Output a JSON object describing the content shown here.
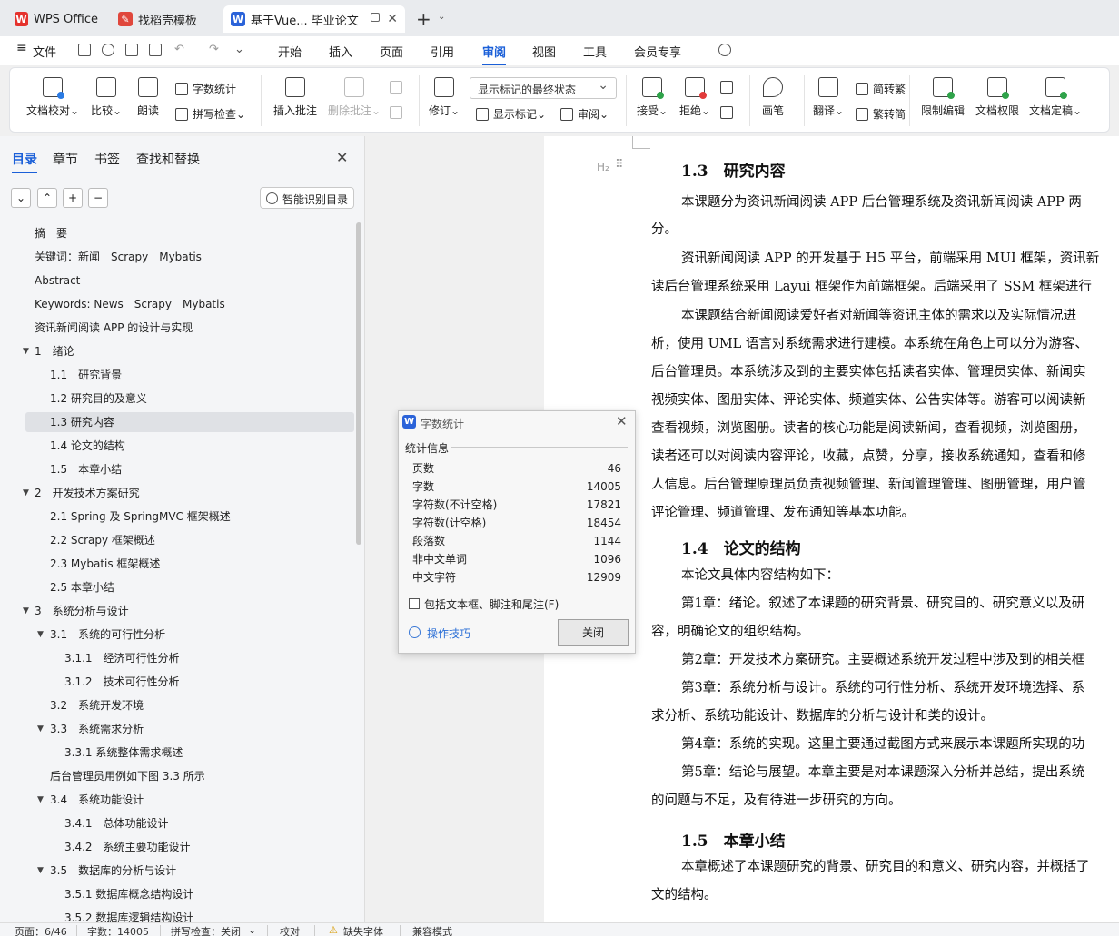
{
  "tabs": [
    {
      "label": "WPS Office",
      "icon": "wps-logo-icon"
    },
    {
      "label": "找稻壳模板",
      "icon": "docer-icon"
    },
    {
      "label": "基于Vue... 毕业论文",
      "icon": "wps-writer-icon"
    }
  ],
  "menu": {
    "file": "文件",
    "items": [
      "开始",
      "插入",
      "页面",
      "引用",
      "审阅",
      "视图",
      "工具",
      "会员专享"
    ]
  },
  "ribbon": {
    "doc_check": "文档校对",
    "compare": "比较",
    "read_aloud": "朗读",
    "word_count": "字数统计",
    "spell_check": "拼写检查",
    "insert_comment": "插入批注",
    "delete_comment": "删除批注",
    "track_changes": "修订",
    "markup_state": "显示标记的最终状态",
    "show_markup": "显示标记",
    "review_pane": "审阅",
    "accept": "接受",
    "reject": "拒绝",
    "pen": "画笔",
    "translate": "翻译",
    "to_traditional": "简转繁",
    "to_simplified": "繁转简",
    "restrict_edit": "限制编辑",
    "doc_permission": "文档权限",
    "doc_finalize": "文档定稿"
  },
  "sidebar": {
    "tabs": [
      "目录",
      "章节",
      "书签",
      "查找和替换"
    ],
    "smart_toc": "智能识别目录",
    "toc": [
      {
        "label": "摘　要",
        "level": 1,
        "arrow": false
      },
      {
        "label": "关键词：新闻　Scrapy　Mybatis",
        "level": 1,
        "arrow": false
      },
      {
        "label": "Abstract",
        "level": 1,
        "arrow": false
      },
      {
        "label": "Keywords: News　Scrapy　Mybatis",
        "level": 1,
        "arrow": false
      },
      {
        "label": "资讯新闻阅读 APP 的设计与实现",
        "level": 1,
        "arrow": false
      },
      {
        "label": "1　绪论",
        "level": 1,
        "arrow": true
      },
      {
        "label": "1.1　研究背景",
        "level": 2,
        "arrow": false
      },
      {
        "label": "1.2 研究目的及意义",
        "level": 2,
        "arrow": false
      },
      {
        "label": "1.3 研究内容",
        "level": 2,
        "arrow": false,
        "selected": true
      },
      {
        "label": "1.4 论文的结构",
        "level": 2,
        "arrow": false
      },
      {
        "label": "1.5　本章小结",
        "level": 2,
        "arrow": false
      },
      {
        "label": "2　开发技术方案研究",
        "level": 1,
        "arrow": true
      },
      {
        "label": "2.1 Spring 及 SpringMVC 框架概述",
        "level": 2,
        "arrow": false
      },
      {
        "label": "2.2 Scrapy 框架概述",
        "level": 2,
        "arrow": false
      },
      {
        "label": "2.3 Mybatis 框架概述",
        "level": 2,
        "arrow": false
      },
      {
        "label": "2.5 本章小结",
        "level": 2,
        "arrow": false
      },
      {
        "label": "3　系统分析与设计",
        "level": 1,
        "arrow": true
      },
      {
        "label": "3.1　系统的可行性分析",
        "level": 2,
        "arrow": true
      },
      {
        "label": "3.1.1　经济可行性分析",
        "level": 3,
        "arrow": false
      },
      {
        "label": "3.1.2　技术可行性分析",
        "level": 3,
        "arrow": false
      },
      {
        "label": "3.2　系统开发环境",
        "level": 2,
        "arrow": false
      },
      {
        "label": "3.3　系统需求分析",
        "level": 2,
        "arrow": true
      },
      {
        "label": "3.3.1 系统整体需求概述",
        "level": 3,
        "arrow": false
      },
      {
        "label": "后台管理员用例如下图 3.3 所示",
        "level": 2,
        "arrow": false
      },
      {
        "label": "3.4　系统功能设计",
        "level": 2,
        "arrow": true
      },
      {
        "label": "3.4.1　总体功能设计",
        "level": 3,
        "arrow": false
      },
      {
        "label": "3.4.2　系统主要功能设计",
        "level": 3,
        "arrow": false
      },
      {
        "label": "3.5　数据库的分析与设计",
        "level": 2,
        "arrow": true
      },
      {
        "label": "3.5.1 数据库概念结构设计",
        "level": 3,
        "arrow": false
      },
      {
        "label": "3.5.2 数据库逻辑结构设计",
        "level": 3,
        "arrow": false
      }
    ]
  },
  "document": {
    "heading_mark": "H₂",
    "lines": [
      {
        "kind": "h",
        "text": "1.3　研究内容"
      },
      {
        "kind": "pi",
        "text": "本课题分为资讯新闻阅读 APP 后台管理系统及资讯新闻阅读 APP 两"
      },
      {
        "kind": "p",
        "text": "分。"
      },
      {
        "kind": "pi",
        "text": "资讯新闻阅读 APP 的开发基于 H5 平台，前端采用 MUI 框架，资讯新"
      },
      {
        "kind": "p",
        "text": "读后台管理系统采用 Layui 框架作为前端框架。后端采用了 SSM 框架进行"
      },
      {
        "kind": "pi",
        "text": "本课题结合新闻阅读爱好者对新闻等资讯主体的需求以及实际情况进"
      },
      {
        "kind": "p",
        "text": "析，使用 UML 语言对系统需求进行建模。本系统在角色上可以分为游客、"
      },
      {
        "kind": "p",
        "text": "后台管理员。本系统涉及到的主要实体包括读者实体、管理员实体、新闻实"
      },
      {
        "kind": "p",
        "text": "视频实体、图册实体、评论实体、频道实体、公告实体等。游客可以阅读新"
      },
      {
        "kind": "p",
        "text": "查看视频，浏览图册。读者的核心功能是阅读新闻，查看视频，浏览图册，"
      },
      {
        "kind": "p",
        "text": "读者还可以对阅读内容评论，收藏，点赞，分享，接收系统通知，查看和修"
      },
      {
        "kind": "p",
        "text": "人信息。后台管理原理员负责视频管理、新闻管理管理、图册管理，用户管"
      },
      {
        "kind": "p",
        "text": "评论管理、频道管理、发布通知等基本功能。"
      },
      {
        "kind": "h",
        "text": "1.4　论文的结构"
      },
      {
        "kind": "pi",
        "text": "本论文具体内容结构如下："
      },
      {
        "kind": "pi",
        "text": "第1章：绪论。叙述了本课题的研究背景、研究目的、研究意义以及研"
      },
      {
        "kind": "p",
        "text": "容，明确论文的组织结构。"
      },
      {
        "kind": "pi",
        "text": "第2章：开发技术方案研究。主要概述系统开发过程中涉及到的相关框"
      },
      {
        "kind": "pi",
        "text": "第3章：系统分析与设计。系统的可行性分析、系统开发环境选择、系"
      },
      {
        "kind": "p",
        "text": "求分析、系统功能设计、数据库的分析与设计和类的设计。"
      },
      {
        "kind": "pi",
        "text": "第4章：系统的实现。这里主要通过截图方式来展示本课题所实现的功"
      },
      {
        "kind": "pi",
        "text": "第5章：结论与展望。本章主要是对本课题深入分析并总结，提出系统"
      },
      {
        "kind": "p",
        "text": "的问题与不足，及有待进一步研究的方向。"
      },
      {
        "kind": "h",
        "text": "1.5　本章小结"
      },
      {
        "kind": "pi",
        "text": "本章概述了本课题研究的背景、研究目的和意义、研究内容，并概括了"
      },
      {
        "kind": "p",
        "text": "文的结构。"
      }
    ]
  },
  "dialog": {
    "title": "字数统计",
    "section": "统计信息",
    "stats": [
      {
        "label": "页数",
        "value": "46"
      },
      {
        "label": "字数",
        "value": "14005"
      },
      {
        "label": "字符数(不计空格)",
        "value": "17821"
      },
      {
        "label": "字符数(计空格)",
        "value": "18454"
      },
      {
        "label": "段落数",
        "value": "1144"
      },
      {
        "label": "非中文单词",
        "value": "1096"
      },
      {
        "label": "中文字符",
        "value": "12909"
      }
    ],
    "include_label": "包括文本框、脚注和尾注(F)",
    "tips": "操作技巧",
    "close": "关闭"
  },
  "status": {
    "page": "页面：6/46",
    "words": "字数：14005",
    "spell": "拼写检查：关闭",
    "proof": "校对",
    "missing_font": "缺失字体",
    "compat": "兼容模式"
  }
}
